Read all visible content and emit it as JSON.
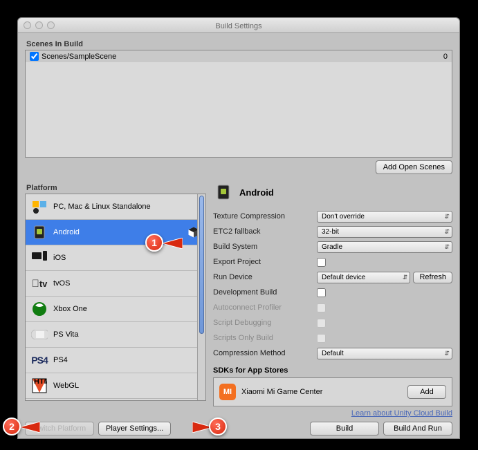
{
  "window": {
    "title": "Build Settings"
  },
  "scenes": {
    "label": "Scenes In Build",
    "items": [
      {
        "name": "Scenes/SampleScene",
        "index": "0"
      }
    ],
    "add_button": "Add Open Scenes"
  },
  "platform": {
    "label": "Platform",
    "items": [
      {
        "label": "PC, Mac & Linux Standalone"
      },
      {
        "label": "Android"
      },
      {
        "label": "iOS"
      },
      {
        "label": "tvOS"
      },
      {
        "label": "Xbox One"
      },
      {
        "label": "PS Vita"
      },
      {
        "label": "PS4"
      },
      {
        "label": "WebGL"
      }
    ]
  },
  "settings": {
    "header_label": "Android",
    "texture_compression": {
      "label": "Texture Compression",
      "value": "Don't override"
    },
    "etc2_fallback": {
      "label": "ETC2 fallback",
      "value": "32-bit"
    },
    "build_system": {
      "label": "Build System",
      "value": "Gradle"
    },
    "export_project": {
      "label": "Export Project"
    },
    "run_device": {
      "label": "Run Device",
      "value": "Default device",
      "refresh": "Refresh"
    },
    "dev_build": {
      "label": "Development Build"
    },
    "autoconnect": {
      "label": "Autoconnect Profiler"
    },
    "script_debug": {
      "label": "Script Debugging"
    },
    "scripts_only": {
      "label": "Scripts Only Build"
    },
    "compression": {
      "label": "Compression Method",
      "value": "Default"
    },
    "sdk_title": "SDKs for App Stores",
    "sdk_item": {
      "label": "Xiaomi Mi Game Center",
      "add": "Add"
    },
    "cloud_link": "Learn about Unity Cloud Build"
  },
  "buttons": {
    "switch_platform": "Switch Platform",
    "player_settings": "Player Settings...",
    "build": "Build",
    "build_and_run": "Build And Run"
  },
  "callouts": {
    "c1": "1",
    "c2": "2",
    "c3": "3"
  }
}
